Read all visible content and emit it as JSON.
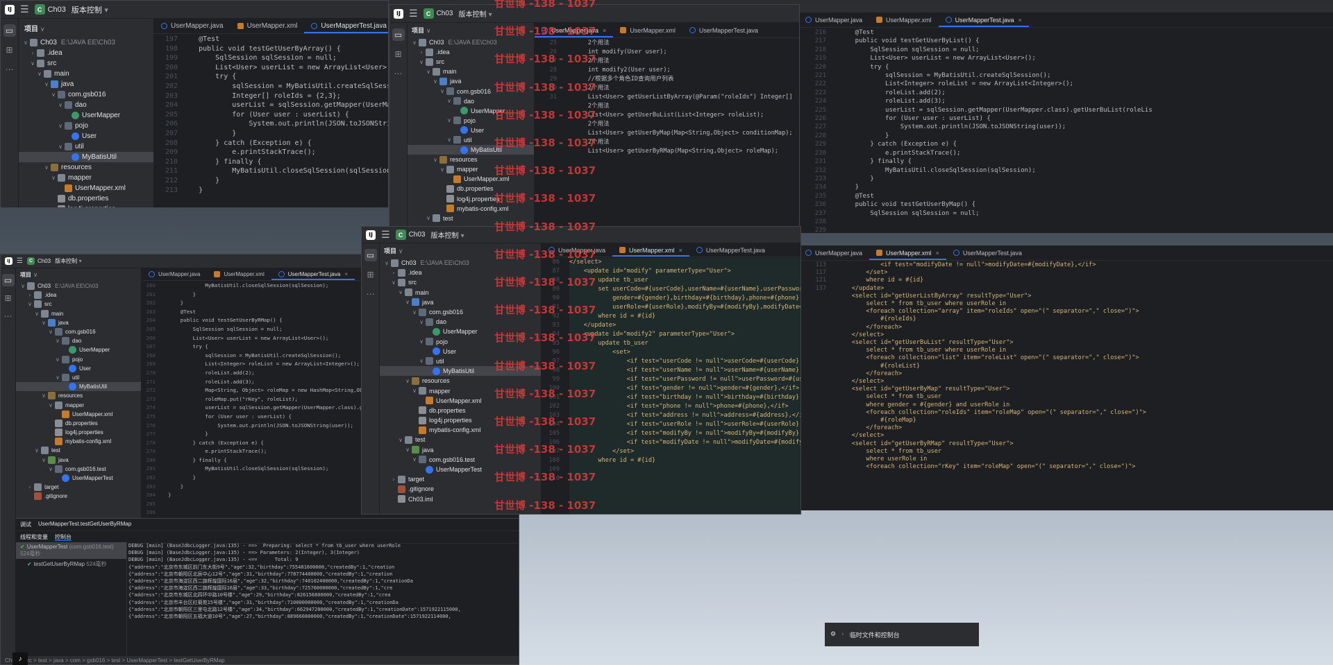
{
  "app": {
    "project_badge": "C",
    "project_name": "Ch03",
    "vcs_label": "版本控制",
    "project_panel_title": "项目",
    "project_root_name": "Ch03",
    "project_root_path": "E:\\JAVA EE\\Ch03"
  },
  "watermark": "甘世博 -138 - 1037",
  "tree": [
    {
      "label": "Ch03",
      "arrow": "∨",
      "icon": "folder",
      "indent": 0
    },
    {
      "label": ".idea",
      "arrow": "›",
      "icon": "folder",
      "indent": 1
    },
    {
      "label": "src",
      "arrow": "∨",
      "icon": "folder",
      "indent": 1
    },
    {
      "label": "main",
      "arrow": "∨",
      "icon": "folder",
      "indent": 2
    },
    {
      "label": "java",
      "arrow": "∨",
      "icon": "src",
      "indent": 3
    },
    {
      "label": "com.gsb016",
      "arrow": "∨",
      "icon": "pkg",
      "indent": 4
    },
    {
      "label": "dao",
      "arrow": "∨",
      "icon": "pkg",
      "indent": 5
    },
    {
      "label": "UserMapper",
      "arrow": "",
      "icon": "int",
      "indent": 6
    },
    {
      "label": "pojo",
      "arrow": "∨",
      "icon": "pkg",
      "indent": 5
    },
    {
      "label": "User",
      "arrow": "",
      "icon": "cls",
      "indent": 6
    },
    {
      "label": "util",
      "arrow": "∨",
      "icon": "pkg",
      "indent": 5
    },
    {
      "label": "MyBatisUtil",
      "arrow": "",
      "icon": "cls",
      "indent": 6
    },
    {
      "label": "resources",
      "arrow": "∨",
      "icon": "res",
      "indent": 3
    },
    {
      "label": "mapper",
      "arrow": "∨",
      "icon": "folder",
      "indent": 4
    },
    {
      "label": "UserMapper.xml",
      "arrow": "",
      "icon": "xml",
      "indent": 5
    },
    {
      "label": "db.properties",
      "arrow": "",
      "icon": "cfg",
      "indent": 4
    },
    {
      "label": "log4j.properties",
      "arrow": "",
      "icon": "cfg",
      "indent": 4
    },
    {
      "label": "mybatis-config.xml",
      "arrow": "",
      "icon": "xml",
      "indent": 4
    },
    {
      "label": "test",
      "arrow": "∨",
      "icon": "folder",
      "indent": 2
    },
    {
      "label": "java",
      "arrow": "∨",
      "icon": "test",
      "indent": 3
    },
    {
      "label": "com.gsb016.test",
      "arrow": "∨",
      "icon": "pkg",
      "indent": 4
    },
    {
      "label": "UserMapperTest",
      "arrow": "",
      "icon": "cls",
      "indent": 5
    },
    {
      "label": "target",
      "arrow": "›",
      "icon": "folder",
      "indent": 1
    },
    {
      "label": ".gitignore",
      "arrow": "",
      "icon": "git",
      "indent": 1
    },
    {
      "label": "Ch03.iml",
      "arrow": "",
      "icon": "cfg",
      "indent": 1
    }
  ],
  "tabs": {
    "java1": "UserMapper.java",
    "xml": "UserMapper.xml",
    "test": "UserMapperTest.java",
    "close": "×"
  },
  "code_a": {
    "lines": [
      "197",
      "198",
      "199",
      "200",
      "201",
      "202",
      "203",
      "204",
      "205",
      "206",
      "207",
      "208",
      "209",
      "210",
      "211",
      "212",
      "213"
    ],
    "text": [
      "    @Test",
      "    public void testGetUserByArray() {",
      "        SqlSession sqlSession = null;",
      "        List<User> userList = new ArrayList<User>();",
      "        try {",
      "            sqlSession = MyBatisUtil.createSqlSession();",
      "            Integer[] roleIds = {2,3};",
      "            userList = sqlSession.getMapper(UserMapper.cl",
      "            for (User user : userList) {",
      "                System.out.println(JSON.toJSONString(user",
      "            }",
      "        } catch (Exception e) {",
      "            e.printStackTrace();",
      "        } finally {",
      "            MyBatisUtil.closeSqlSession(sqlSession);",
      "        }",
      "    }"
    ]
  },
  "code_b": {
    "lines": [
      "25",
      "",
      "26",
      "",
      "27",
      "28",
      "",
      "29",
      "",
      "30",
      "",
      "31"
    ],
    "text": [
      "",
      "    2个用法",
      "    int modify(User user);",
      "",
      "    2个用法",
      "    int modify2(User user);",
      "",
      "    //根据多个角色ID查询用户列表",
      "    2个用法",
      "    List<User> getUserListByArray(@Param(\"roleIds\") Integer[]",
      "",
      "    2个用法",
      "    List<User> getUserBuList(List<Integer> roleList);",
      "",
      "    2个用法",
      "    List<User> getUserByMap(Map<String,Object> conditionMap);",
      "",
      "    2个用法",
      "    List<User> getUserByRMap(Map<String,Object> roleMap);"
    ]
  },
  "code_c": {
    "lines": [
      "216",
      "217",
      "218",
      "219",
      "220",
      "221",
      "222",
      "223",
      "224",
      "225",
      "226",
      "227",
      "228",
      "229",
      "230",
      "231",
      "232",
      "233",
      "234",
      "235",
      "236",
      "237",
      "238",
      "239"
    ],
    "text": [
      "    @Test",
      "    public void testGetUserByList() {",
      "        SqlSession sqlSession = null;",
      "        List<User> userList = new ArrayList<User>();",
      "        try {",
      "            sqlSession = MyBatisUtil.createSqlSession();",
      "            List<Integer> roleList = new ArrayList<Integer>();",
      "            roleList.add(2);",
      "            roleList.add(3);",
      "            userList = sqlSession.getMapper(UserMapper.class).getUserBuList(roleLis",
      "            for (User user : userList) {",
      "                System.out.println(JSON.toJSONString(user));",
      "            }",
      "        } catch (Exception e) {",
      "            e.printStackTrace();",
      "        } finally {",
      "            MyBatisUtil.closeSqlSession(sqlSession);",
      "        }",
      "    }",
      "",
      "",
      "    @Test",
      "    public void testGetUserByMap() {",
      "        SqlSession sqlSession = null;"
    ]
  },
  "code_d": {
    "lines": [
      "260",
      "261",
      "262",
      "263",
      "264",
      "265",
      "266",
      "267",
      "268",
      "269",
      "270",
      "271",
      "272",
      "273",
      "274",
      "275",
      "276",
      "277",
      "278",
      "279",
      "280",
      "281",
      "282",
      "283",
      "284",
      "285",
      "286",
      "287"
    ],
    "text": [
      "            MyBatisUtil.closeSqlSession(sqlSession);",
      "        }",
      "    }",
      "",
      "    @Test",
      "    public void testGetUserByRMap() {",
      "        SqlSession sqlSession = null;",
      "        List<User> userList = new ArrayList<User>();",
      "        try {",
      "            sqlSession = MyBatisUtil.createSqlSession();",
      "            List<Integer> roleList = new ArrayList<Integer>();",
      "            roleList.add(2);",
      "            roleList.add(3);",
      "            Map<String, Object> roleMap = new HashMap<String,Object>();",
      "            roleMap.put(\"rKey\", roleList);",
      "            userList = sqlSession.getMapper(UserMapper.class).getUserByRMap(roleMap);",
      "            for (User user : userList) {",
      "                System.out.println(JSON.toJSONString(user));",
      "            }",
      "        } catch (Exception e) {",
      "            e.printStackTrace();",
      "        } finally {",
      "            MyBatisUtil.closeSqlSession(sqlSession);",
      "        }",
      "    }",
      "",
      "}",
      ""
    ]
  },
  "code_e": {
    "lines": [
      "",
      "86",
      "87",
      "88",
      "89",
      "90",
      "91",
      "92",
      "93",
      "94",
      "95",
      "96",
      "97",
      "98",
      "99",
      "100",
      "101",
      "102",
      "103",
      "104",
      "105",
      "106",
      "107",
      "108",
      "109",
      "110"
    ],
    "text": [
      "</select>",
      "",
      "    <update id=\"modify\" parameterType=\"User\">",
      "        update tb_user",
      "        set userCode=#{userCode},userName=#{userName},userPassword=#{userPasswo",
      "            gender=#{gender},birthday=#{birthday},phone=#{phone}, address=#{add",
      "            userRole=#{userRole},modifyBy=#{modifyBy},modifyDate=#{modifyDate}",
      "        where id = #{id}",
      "    </update>",
      "",
      "    <update id=\"modify2\" parameterType=\"User\">",
      "        update tb_user",
      "            <set>",
      "                <if test=\"userCode != null\">userCode=#{userCode},</if>",
      "                <if test=\"userName != null\">userName=#{userName},</if>",
      "                <if test=\"userPassword != null\">userPassword=#{userPassword},</",
      "                <if test=\"gender != null\">gender=#{gender},</if>",
      "                <if test=\"birthday != null\">birthday=#{birthday},</if>",
      "                <if test=\"phone != null\">phone=#{phone},</if>",
      "                <if test=\"address != null\">address=#{address},</if>",
      "                <if test=\"userRole != null\">userRole=#{userRole},</if>",
      "                <if test=\"modifyBy != null\">modifyBy=#{modifyBy},</if>",
      "                <if test=\"modifyDate != null\">modifyDate=#{modifyDate},</if>",
      "            </set>",
      "",
      "        where id = #{id}"
    ]
  },
  "code_f": {
    "lines": [
      "",
      "",
      "",
      "",
      "113",
      "",
      "",
      "",
      "117",
      "",
      "",
      "",
      "121",
      "",
      "",
      "",
      "",
      "",
      "",
      "",
      "",
      "",
      "",
      "",
      "137",
      ""
    ],
    "text": [
      "            <if test=\"modifyDate != null\">modifyDate=#{modifyDate},</if>",
      "        </set>",
      "",
      "        where id = #{id}",
      "    </update>",
      "",
      "    <select id=\"getUserListByArray\" resultType=\"User\">",
      "        select * from tb_user where userRole in",
      "        <foreach collection=\"array\" item=\"roleIds\" open=\"(\" separator=\",\" close=\")\">",
      "            #{roleIds}",
      "        </foreach>",
      "    </select>",
      "",
      "    <select id=\"getUserBuList\" resultType=\"User\">",
      "        select * from tb_user where userRole in",
      "        <foreach collection=\"list\" item=\"roleList\" open=\"(\" separator=\",\" close=\")\">",
      "            #{roleList}",
      "        </foreach>",
      "    </select>",
      "",
      "    <select id=\"getUserByMap\" resultType=\"User\">",
      "        select * from tb_user",
      "        where gender = #{gender} and userRole in",
      "        <foreach collection=\"roleIds\" item=\"roleMap\" open=\"(\" separator=\",\" close=\")\">",
      "            #{roleMap}",
      "        </foreach>",
      "    </select>",
      "",
      "    <select id=\"getUserByRMap\" resultType=\"User\">",
      "        select * from tb_user",
      "        where userRole in",
      "        <foreach collection=\"rKey\" item=\"roleMap\" open=\"(\" separator=\",\" close=\")\">"
    ]
  },
  "debug": {
    "panel_label": "调试",
    "session_tab": "UserMapperTest.testGetUserByRMap",
    "thread_tab": "线程和变量",
    "console_tab": "控制台",
    "test_root": "UserMapperTest",
    "test_root_pkg": "(com.gsb016.test)",
    "test_root_time": "524毫秒",
    "test_child": "testGetUserByRMap",
    "test_child_time": "524毫秒",
    "log": [
      "DEBUG [main] (BaseJdbcLogger.java:135) - ==>  Preparing: select * from tb_user where userRole",
      "DEBUG [main] (BaseJdbcLogger.java:135) - ==> Parameters: 2(Integer), 3(Integer)",
      "DEBUG [main] (BaseJdbcLogger.java:135) - <==      Total: 9",
      "{\"address\":\"北京市东城区前门东大街9号\",\"age\":32,\"birthday\":755481600000,\"createdBy\":1,\"creation",
      "{\"address\":\"北京市朝阳区北辰中心12号\",\"age\":31,\"birthday\":778774400000,\"createdBy\":1,\"creation",
      "{\"address\":\"北京市海淀区西二旗辉煌国际16层\",\"age\":32,\"birthday\":740102400000,\"createdBy\":1,\"creationDa",
      "{\"address\":\"北京市海淀区西二旗辉煌国际16层\",\"age\":33,\"birthday\":725760000000,\"createdBy\":1,\"cre",
      "{\"address\":\"北京市东城区北四环中路10号楼\",\"age\":29,\"birthday\":826156800000,\"createdBy\":1,\"crea",
      "{\"address\":\"北京市丰台区红菊苑15号楼\",\"age\":31,\"birthday\":710000000000,\"createdBy\":1,\"creationDa",
      "{\"address\":\"北京市朝阳区三里屯北路12号楼\",\"age\":34,\"birthday\":662947200000,\"createdBy\":1,\"creationDate\":1571922115000,",
      "{\"address\":\"北京市朝阳区五福大道10号\",\"age\":27,\"birthday\":889660800000,\"createdBy\":1,\"creationDate\":1571922114000,"
    ],
    "status_path": "Ch03 > src > test > java > com > gsb016 > test > UserMapperTest > testGetUserByRMap"
  },
  "corner": {
    "label": "临时文件和控制台"
  }
}
